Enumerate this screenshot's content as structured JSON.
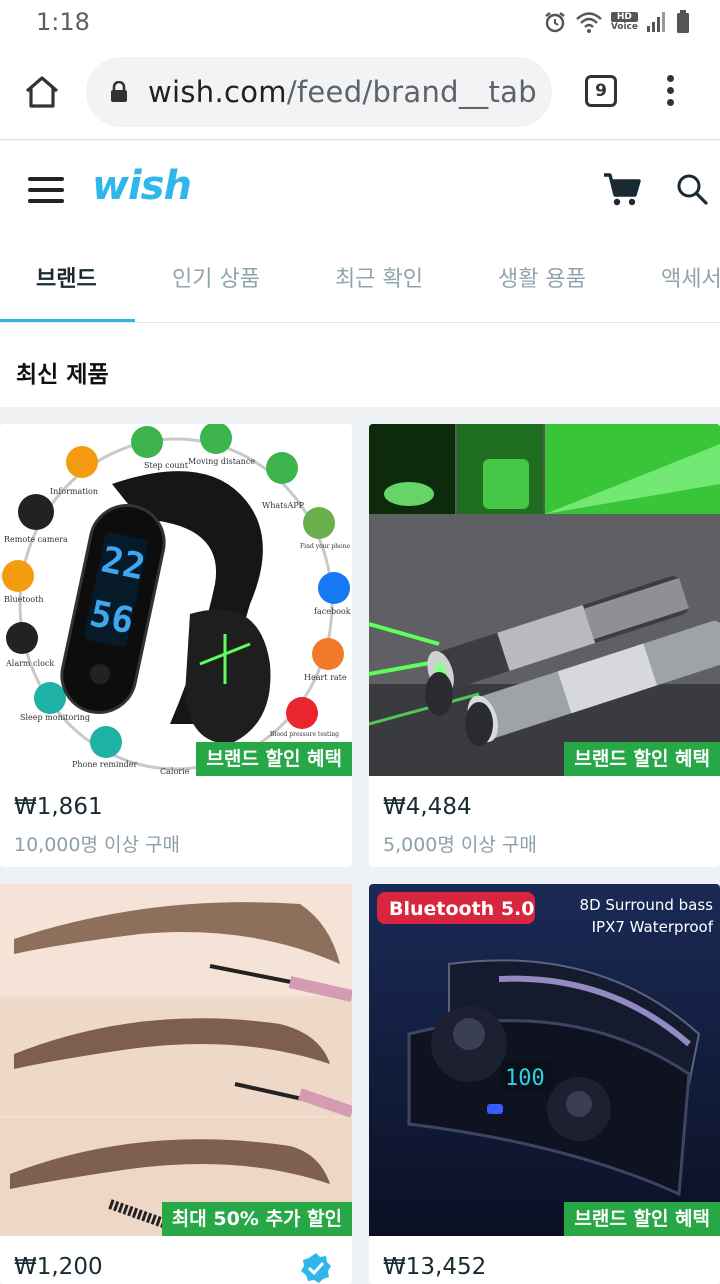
{
  "status_bar": {
    "time": "1:18",
    "icons": [
      "alarm-icon",
      "wifi-icon",
      "hd-voice-icon",
      "signal-icon",
      "battery-icon"
    ],
    "hd_voice_top": "HD",
    "hd_voice_bottom": "Voice"
  },
  "browser": {
    "url_main": "wish.com",
    "url_path": "/feed/brand__tab",
    "tab_count": "9"
  },
  "header": {
    "logo": "wish",
    "accent_color": "#2fb7ec"
  },
  "tabs": [
    {
      "label": "브랜드",
      "active": true
    },
    {
      "label": "인기 상품",
      "active": false
    },
    {
      "label": "최근 확인",
      "active": false
    },
    {
      "label": "생활 용품",
      "active": false
    },
    {
      "label": "액세서",
      "active": false
    }
  ],
  "section": {
    "title": "최신 제품"
  },
  "products": [
    {
      "name": "fitness-band",
      "badge": "브랜드 할인 혜택",
      "price": "₩1,861",
      "sold": "10,000명 이상 구매"
    },
    {
      "name": "laser-pointer",
      "badge": "브랜드 할인 혜택",
      "price": "₩4,484",
      "sold": "5,000명 이상 구매"
    },
    {
      "name": "eyebrow-pencil",
      "badge": "최대 50% 추가 할인",
      "price": "₩1,200",
      "sold": "",
      "verified": true
    },
    {
      "name": "bluetooth-earbuds",
      "badge": "브랜드 할인 혜택",
      "price": "₩13,452",
      "sold": ""
    }
  ],
  "image_texts": {
    "fitness": {
      "display_top": "22",
      "display_bottom": "56",
      "labels": [
        "Step count",
        "Moving distance",
        "WhatsAPP",
        "Find your phone",
        "facebook",
        "Heart rate",
        "Blood pressure testing",
        "Calorie",
        "Phone reminder",
        "Sleep monitoring",
        "Alarm clock",
        "Bluetooth",
        "Remote camera",
        "Information"
      ]
    },
    "earbuds": {
      "bt_label": "Bluetooth 5.0",
      "feature_1": "8D Surround bass",
      "feature_2": "IPX7 Waterproof",
      "case_display": "100"
    }
  },
  "colors": {
    "promo_green": "#27a745",
    "text_dark": "#192a32",
    "text_muted": "#8aa0ab",
    "tab_inactive": "#90a4b0"
  }
}
